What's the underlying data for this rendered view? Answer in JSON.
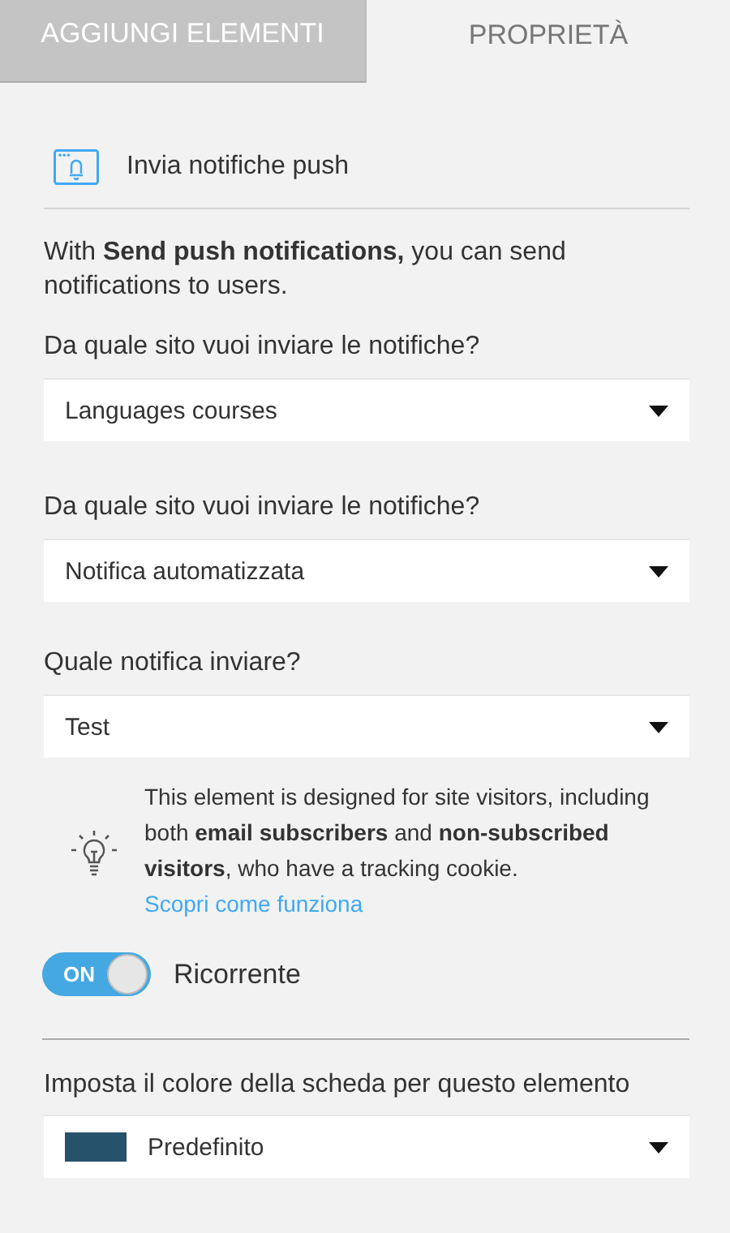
{
  "tabs": [
    {
      "label": "AGGIUNGI ELEMENTI",
      "selected": false
    },
    {
      "label": "PROPRIETÀ",
      "selected": true
    }
  ],
  "element": {
    "title": "Invia notifiche push"
  },
  "description": "With **Send push notifications,** you can send notifications to users.",
  "fields": [
    {
      "label": "Da quale sito vuoi inviare le notifiche?",
      "value": "Languages courses"
    },
    {
      "label": "Da quale sito vuoi inviare le notifiche?",
      "value": "Notifica automatizzata"
    },
    {
      "label": "Quale notifica inviare?",
      "value": "Test"
    }
  ],
  "info": {
    "text": "This element is designed for site visitors, including both **email subscribers** and **non-subscribed visitors**, who have a tracking cookie.",
    "link": "Scopri come funziona"
  },
  "toggle": {
    "on_label": "ON",
    "label": "Ricorrente",
    "on": true
  },
  "tab_color": {
    "label": "Imposta il colore della scheda per questo elemento",
    "value": "Predefinito",
    "color": "#26526b"
  }
}
